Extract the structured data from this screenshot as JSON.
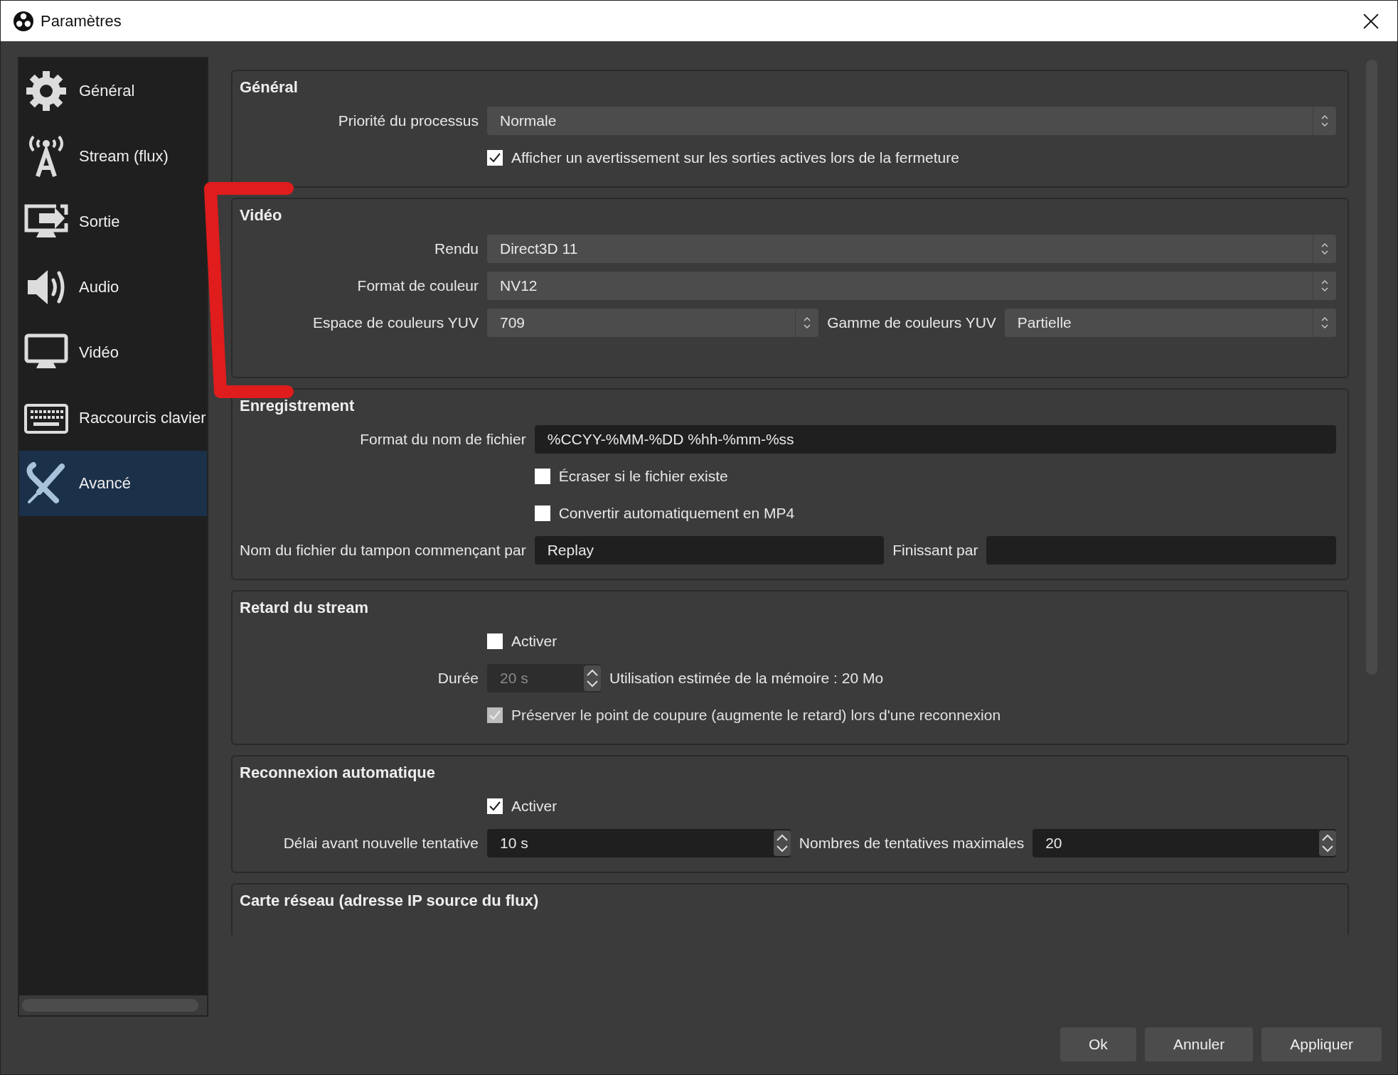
{
  "window": {
    "title": "Paramètres"
  },
  "sidebar": {
    "items": [
      {
        "label": "Général",
        "selected": false
      },
      {
        "label": "Stream (flux)",
        "selected": false
      },
      {
        "label": "Sortie",
        "selected": false
      },
      {
        "label": "Audio",
        "selected": false
      },
      {
        "label": "Vidéo",
        "selected": false
      },
      {
        "label": "Raccourcis clavier",
        "selected": false
      },
      {
        "label": "Avancé",
        "selected": true
      }
    ]
  },
  "groups": [
    {
      "title": "Général",
      "rows": [
        {
          "label": "Priorité du processus",
          "controls": [
            {
              "kind": "select",
              "value": "Normale"
            }
          ]
        },
        {
          "controls": [
            {
              "kind": "check",
              "text": "Afficher un avertissement sur les sorties actives lors de la fermeture",
              "checked": true,
              "disabled": false
            }
          ]
        }
      ]
    },
    {
      "title": "Vidéo",
      "rows": [
        {
          "label": "Rendu",
          "controls": [
            {
              "kind": "select",
              "value": "Direct3D 11"
            }
          ]
        },
        {
          "label": "Format de couleur",
          "controls": [
            {
              "kind": "select",
              "value": "NV12"
            }
          ]
        },
        {
          "label": "Espace de couleurs YUV",
          "controls": [
            {
              "kind": "select",
              "value": "709"
            },
            {
              "kind": "label",
              "text": "Gamme de couleurs YUV"
            },
            {
              "kind": "select",
              "value": "Partielle"
            }
          ]
        }
      ]
    },
    {
      "title": "Enregistrement",
      "rows": [
        {
          "label": "Format du nom de fichier",
          "controls": [
            {
              "kind": "text",
              "value": "%CCYY-%MM-%DD %hh-%mm-%ss"
            }
          ]
        },
        {
          "controls": [
            {
              "kind": "check",
              "text": "Écraser si le fichier existe",
              "checked": false,
              "disabled": false
            }
          ]
        },
        {
          "controls": [
            {
              "kind": "check",
              "text": "Convertir automatiquement en MP4",
              "checked": false,
              "disabled": false
            }
          ]
        },
        {
          "label": "Nom du fichier du tampon commençant par",
          "controls": [
            {
              "kind": "text",
              "value": "Replay"
            },
            {
              "kind": "label",
              "text": "Finissant par"
            },
            {
              "kind": "text"
            }
          ]
        }
      ]
    },
    {
      "title": "Retard du stream",
      "rows": [
        {
          "controls": [
            {
              "kind": "check",
              "text": "Activer",
              "checked": false,
              "disabled": false
            }
          ]
        },
        {
          "label": "Durée",
          "controls": [
            {
              "kind": "spin",
              "value": "20 s",
              "disabled": true
            },
            {
              "kind": "note",
              "text": "Utilisation estimée de la mémoire : 20 Mo"
            }
          ]
        },
        {
          "controls": [
            {
              "kind": "check",
              "text": "Préserver le point de coupure (augmente le retard) lors d'une reconnexion",
              "checked": true,
              "disabled": true
            }
          ]
        }
      ]
    },
    {
      "title": "Reconnexion automatique",
      "rows": [
        {
          "controls": [
            {
              "kind": "check",
              "text": "Activer",
              "checked": true,
              "disabled": false
            }
          ]
        },
        {
          "label": "Délai avant nouvelle tentative",
          "controls": [
            {
              "kind": "spin",
              "value": "10 s",
              "disabled": false
            },
            {
              "kind": "label",
              "text": "Nombres de tentatives maximales"
            },
            {
              "kind": "spin",
              "value": "20",
              "disabled": false
            }
          ]
        }
      ]
    },
    {
      "title": "Carte réseau (adresse IP source du flux)"
    }
  ],
  "buttons": [
    "Ok",
    "Annuler",
    "Appliquer"
  ]
}
